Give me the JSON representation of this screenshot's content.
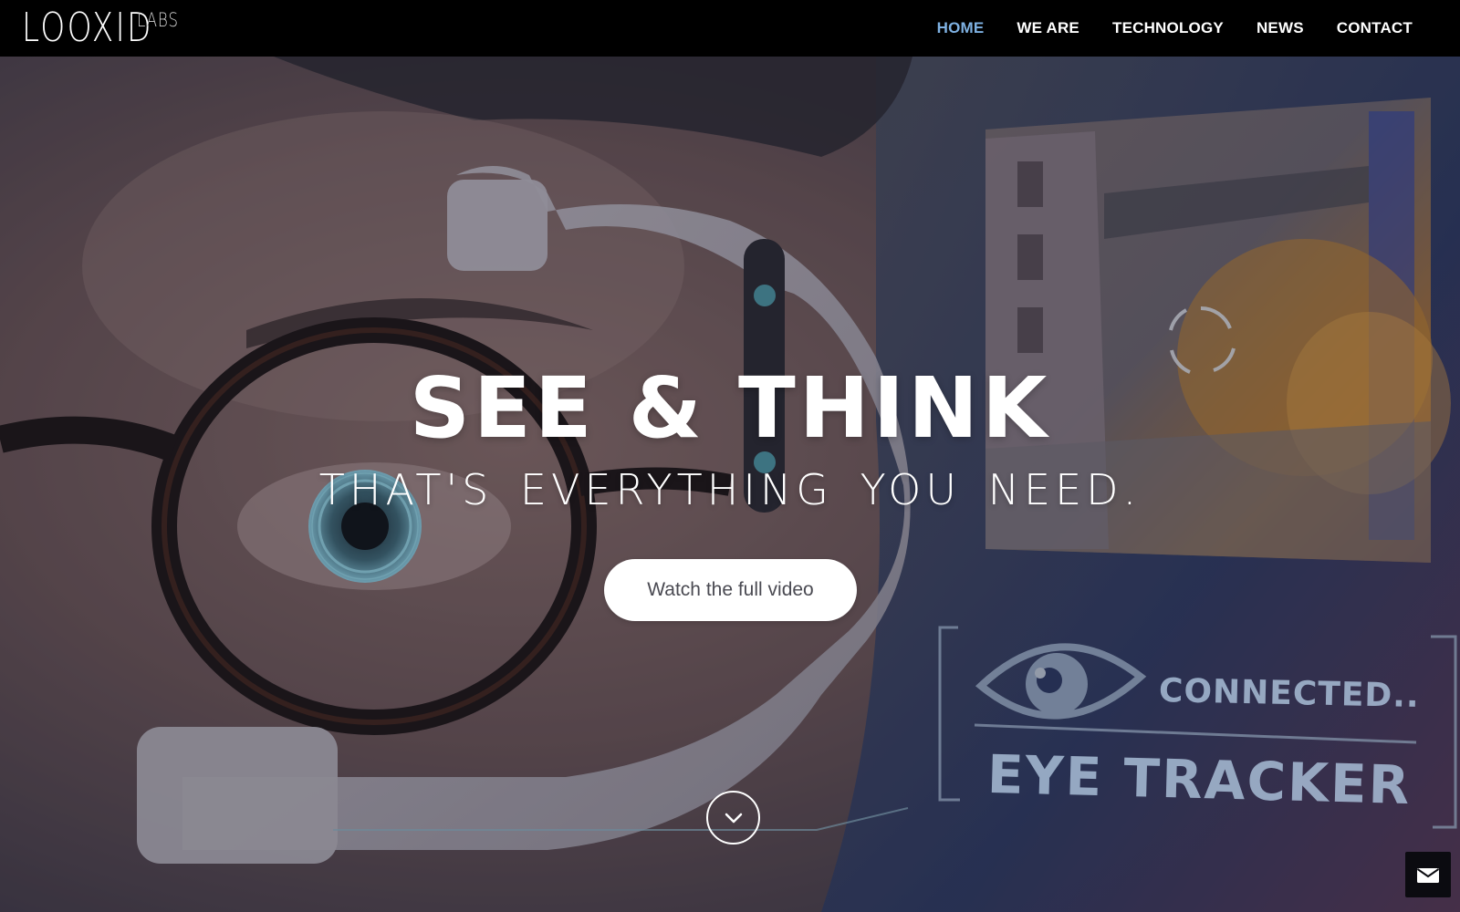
{
  "brand": {
    "logo_main": "LOOXID",
    "logo_sub": "LABS"
  },
  "nav": {
    "items": [
      {
        "label": "HOME",
        "active": true
      },
      {
        "label": "WE ARE",
        "active": false
      },
      {
        "label": "TECHNOLOGY",
        "active": false
      },
      {
        "label": "NEWS",
        "active": false
      },
      {
        "label": "CONTACT",
        "active": false
      }
    ],
    "active_color": "#7eb1e2"
  },
  "hero": {
    "title": "SEE & THINK",
    "subtitle": "THAT'S EVERYTHING YOU NEED.",
    "cta_label": "Watch the full video",
    "hud_connected": "CONNECTED..",
    "hud_eye_tracker": "EYE TRACKER"
  },
  "icons": {
    "scroll": "chevron-down-icon",
    "mail": "envelope-icon",
    "hud": "eye-icon",
    "target": "target-reticle-icon"
  }
}
